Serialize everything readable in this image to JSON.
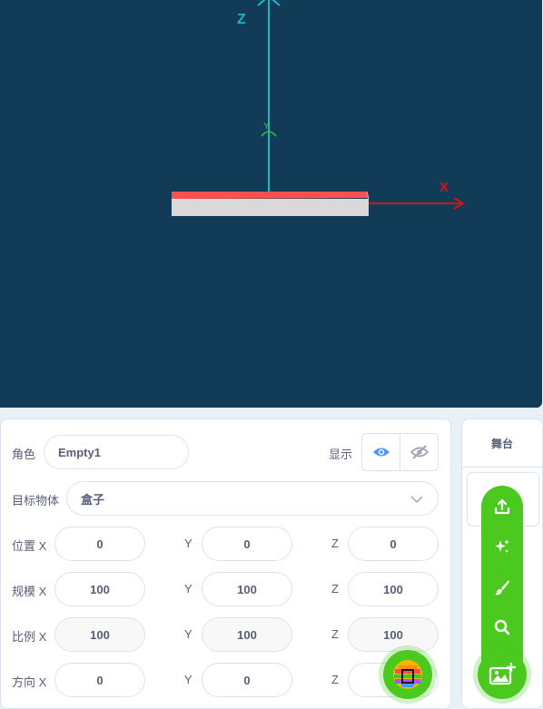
{
  "viewport": {
    "axes": {
      "x_label": "X",
      "y_label": "Y",
      "z_label": "Z"
    },
    "colors": {
      "background": "#123b58",
      "x_axis": "#c81919",
      "y_axis": "#2ecc40",
      "z_axis": "#17b8c8",
      "box_top": "#ff5050",
      "box_front": "#d9d9d9"
    }
  },
  "props": {
    "sprite_label": "角色",
    "sprite_name": "Empty1",
    "show_label": "显示",
    "target_label": "目标物体",
    "target_value": "盒子",
    "position": {
      "label": "位置 X",
      "x": "0",
      "y_label": "Y",
      "y": "0",
      "z_label": "Z",
      "z": "0"
    },
    "scale": {
      "label": "规模 X",
      "x": "100",
      "y_label": "Y",
      "y": "100",
      "z_label": "Z",
      "z": "100"
    },
    "ratio": {
      "label": "比例 X",
      "x": "100",
      "y_label": "Y",
      "y": "100",
      "z_label": "Z",
      "z": "100"
    },
    "direction": {
      "label": "方向 X",
      "x": "0",
      "y_label": "Y",
      "y": "0",
      "z_label": "Z",
      "z": ""
    }
  },
  "stage": {
    "title": "舞台"
  },
  "icons": {
    "visible": "eye-icon",
    "hidden": "eye-slash-icon",
    "upload": "upload-icon",
    "surprise": "sparkles-icon",
    "paint": "paintbrush-icon",
    "search": "search-icon",
    "add_backdrop": "image-plus-icon",
    "extension": "extension-icon"
  },
  "accent_color": "#4bc91f"
}
